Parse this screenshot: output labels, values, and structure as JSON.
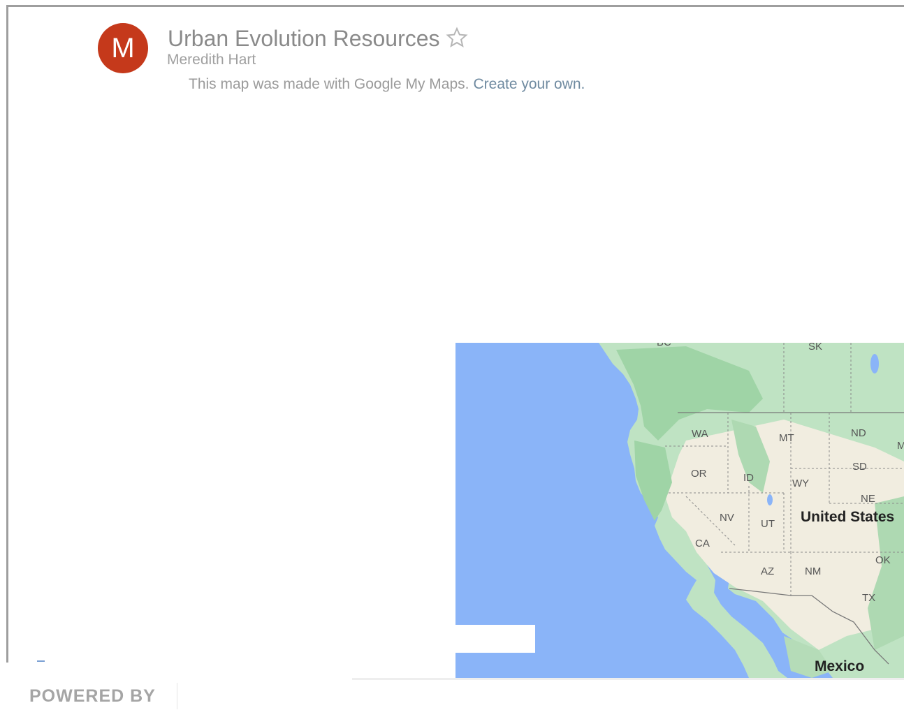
{
  "header": {
    "avatar_letter": "M",
    "title": "Urban Evolution Resources",
    "owner": "Meredith Hart",
    "made_with": "This map was made with Google My Maps.",
    "create_link": "Create your own."
  },
  "map": {
    "water_color": "#8ab4f8",
    "labels": {
      "bc": "BC",
      "sk": "SK",
      "wa": "WA",
      "mt": "MT",
      "nd": "ND",
      "mn": "M",
      "or": "OR",
      "id": "ID",
      "wy": "WY",
      "sd": "SD",
      "ne": "NE",
      "nv": "NV",
      "ut": "UT",
      "us": "United States",
      "ca": "CA",
      "az": "AZ",
      "nm": "NM",
      "ok": "OK",
      "tx": "TX",
      "mx": "Mexico"
    }
  },
  "footer": {
    "powered_by": "POWERED BY"
  },
  "colors": {
    "avatar": "#c5391b",
    "link": "#6f8aa0"
  }
}
